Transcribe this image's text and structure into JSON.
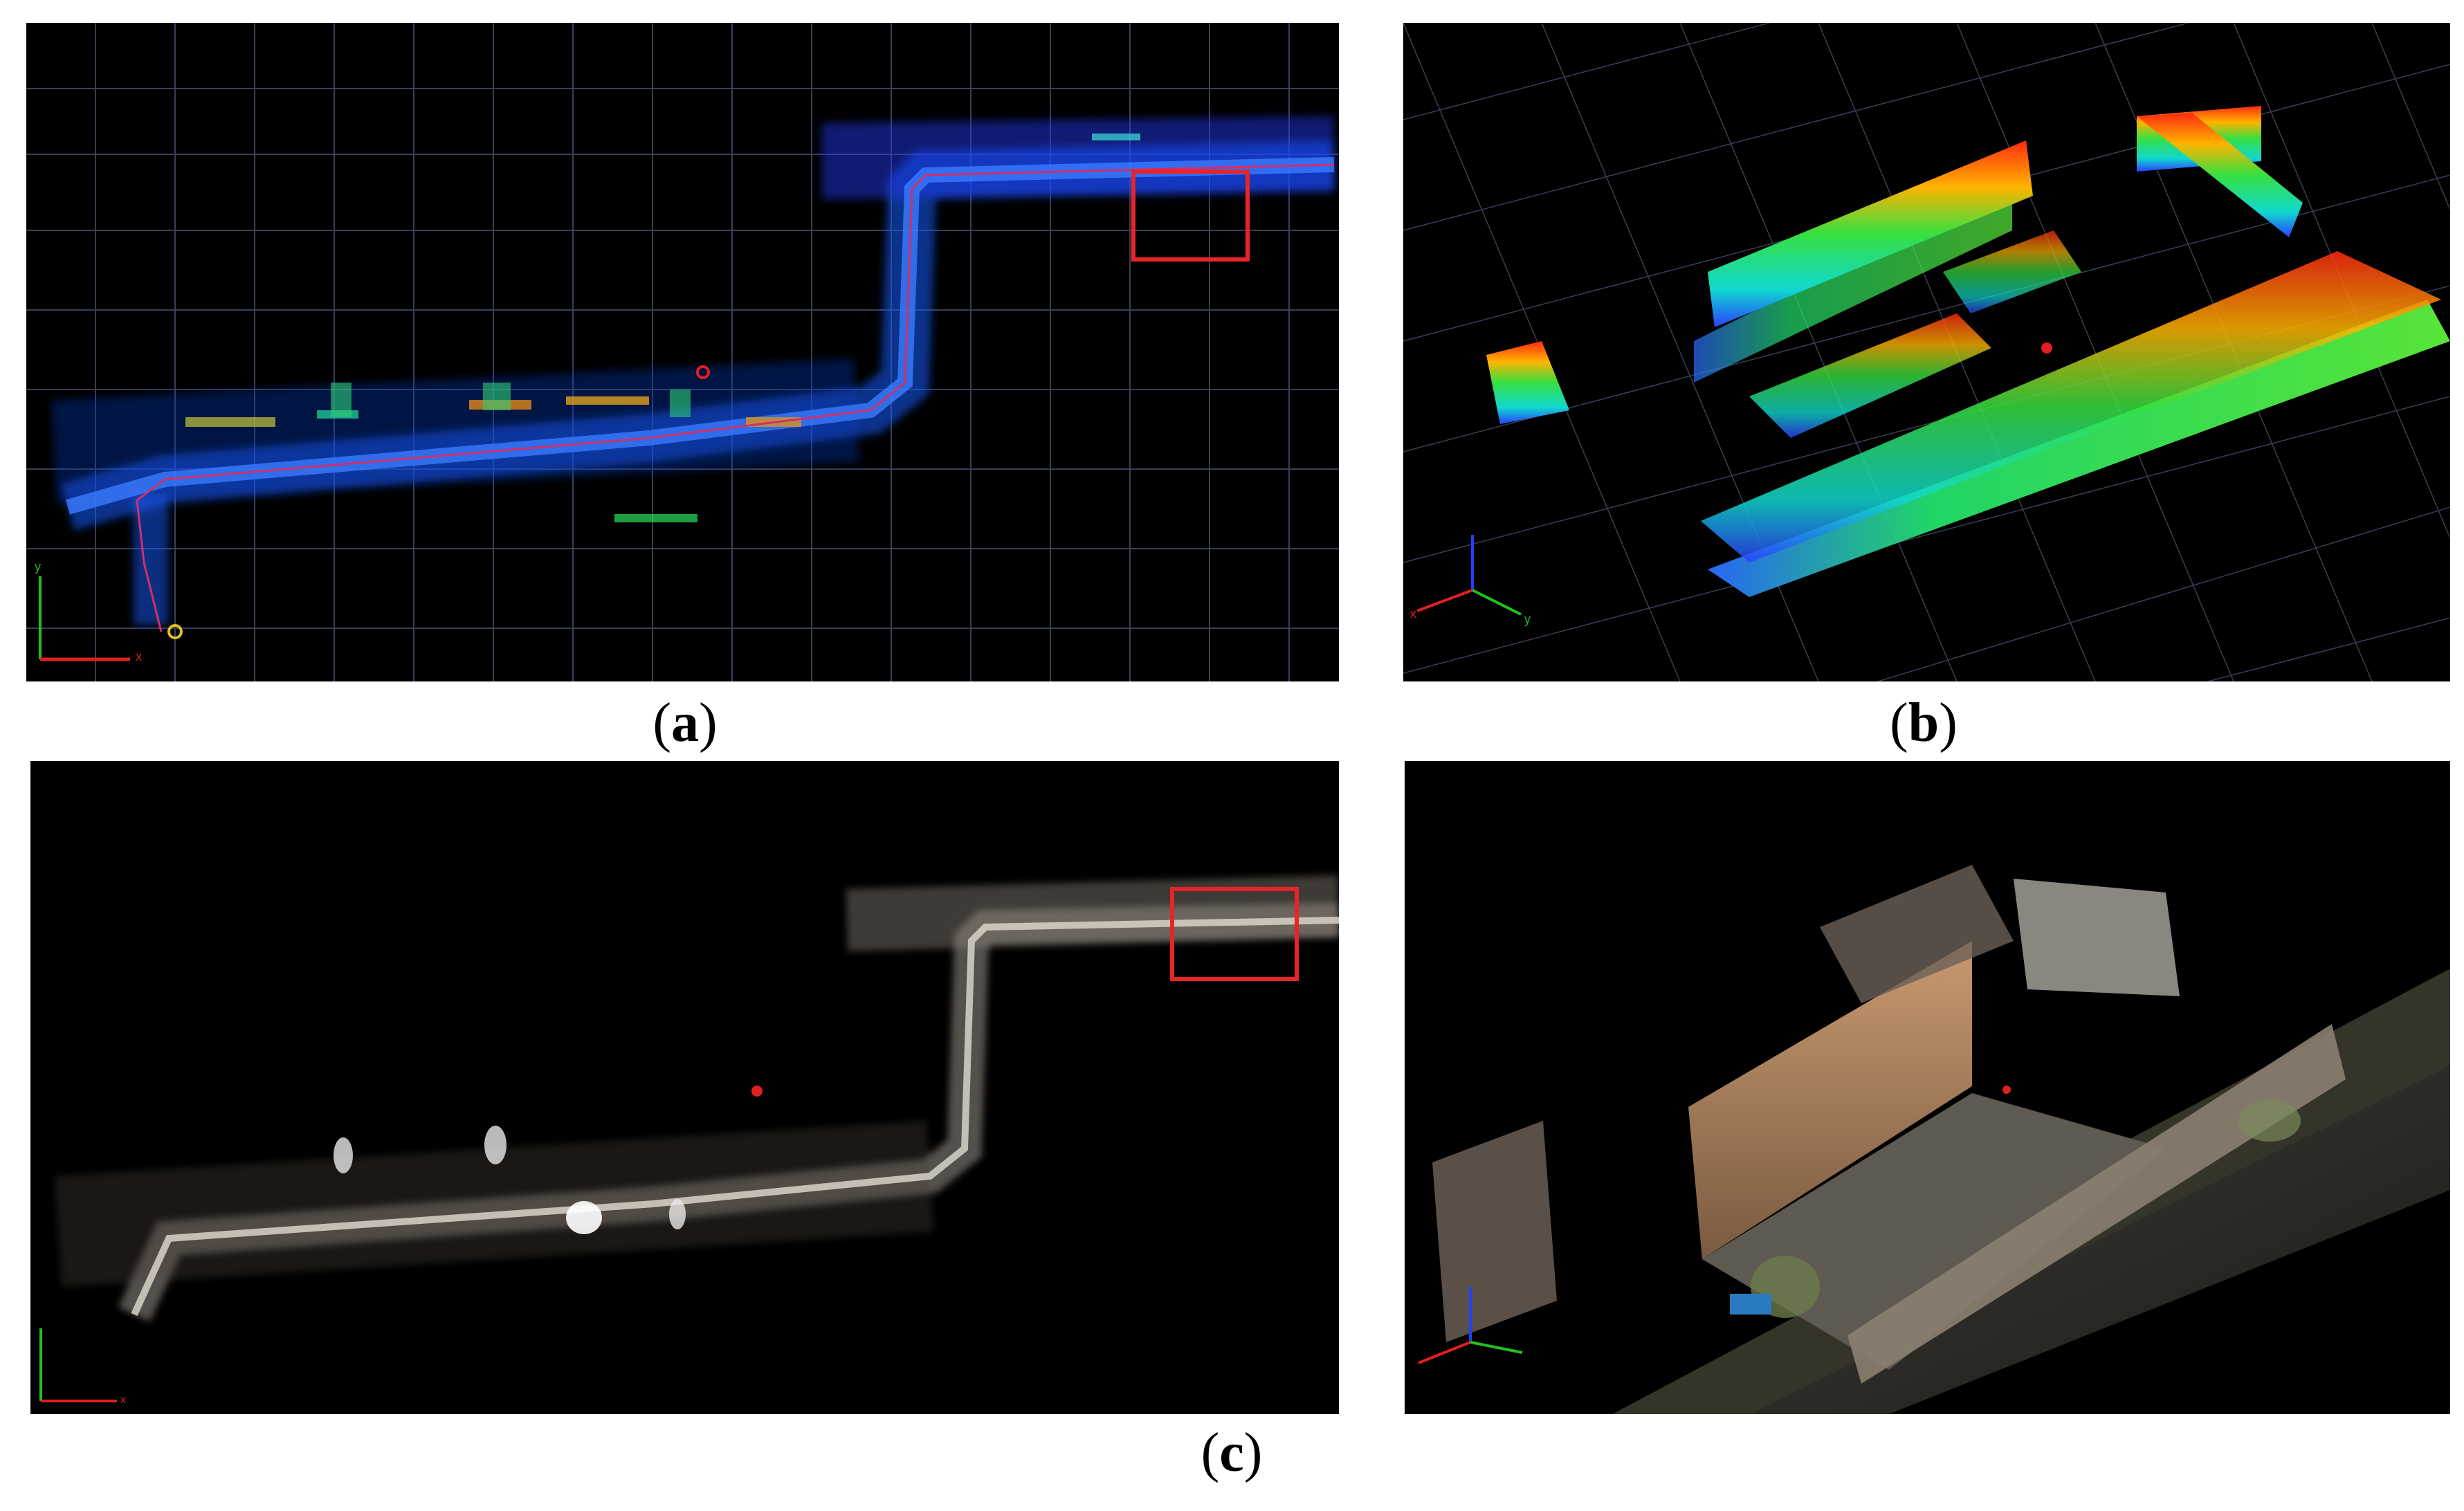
{
  "figure": {
    "panels": [
      {
        "id": "a",
        "view": "top-down point cloud, height-colored",
        "has_highlight_box": true
      },
      {
        "id": "b",
        "view": "oblique point cloud, height-colored"
      },
      {
        "id": "c-left",
        "view": "top-down point cloud, RGB-colored",
        "has_highlight_box": true
      },
      {
        "id": "c-right",
        "view": "oblique point cloud, RGB-colored"
      }
    ],
    "captions": {
      "a": "a",
      "b": "b",
      "c": "c"
    },
    "axis_labels": {
      "x": "x",
      "y": "y"
    }
  },
  "colors": {
    "background": "#000000",
    "grid": "#3a3f55",
    "highlight_box": "#e8242a",
    "trajectory": "#d0306a",
    "axis_x": "#e02020",
    "axis_y": "#20c020",
    "axis_z": "#2040ff"
  }
}
